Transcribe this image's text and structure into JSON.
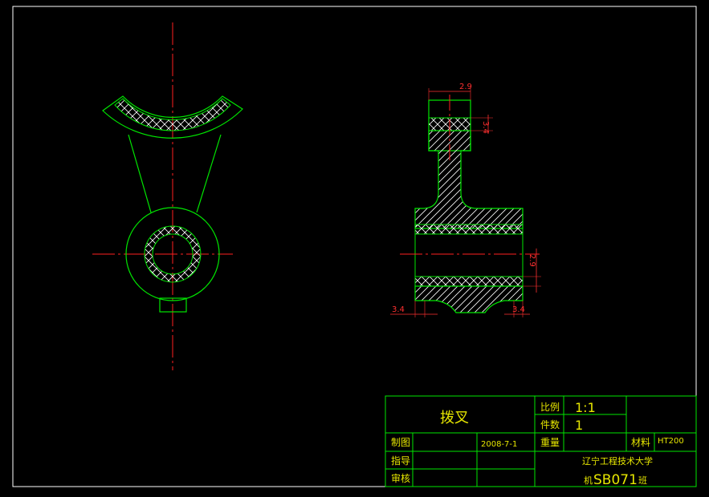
{
  "colors": {
    "background": "#000000",
    "outline": "#00e600",
    "centerline": "#ff2020",
    "dimension": "#ff3030",
    "hatch": "#ffffff",
    "frame": "#ffffff",
    "titleblock_text_yellow": "#e6e600",
    "titleblock_text_green": "#00e600"
  },
  "drawing": {
    "dimensions": {
      "top_width": "2.9",
      "top_wall": "3.4",
      "right_gap": "2.9",
      "bottom_left": "3.4",
      "bottom_right": "3.4"
    }
  },
  "title_block": {
    "part_name": "拨叉",
    "scale_label": "比例",
    "scale_value": "1:1",
    "quantity_label": "件数",
    "quantity_value": "1",
    "drawn_label": "制图",
    "date": "2008-7-1",
    "weight_label": "重量",
    "material_label": "材料",
    "material_value": "HT200",
    "guide_label": "指导",
    "review_label": "审核",
    "school": "辽宁工程技术大学",
    "class_prefix": "机",
    "class_code": "SB071",
    "class_suffix": "班"
  }
}
